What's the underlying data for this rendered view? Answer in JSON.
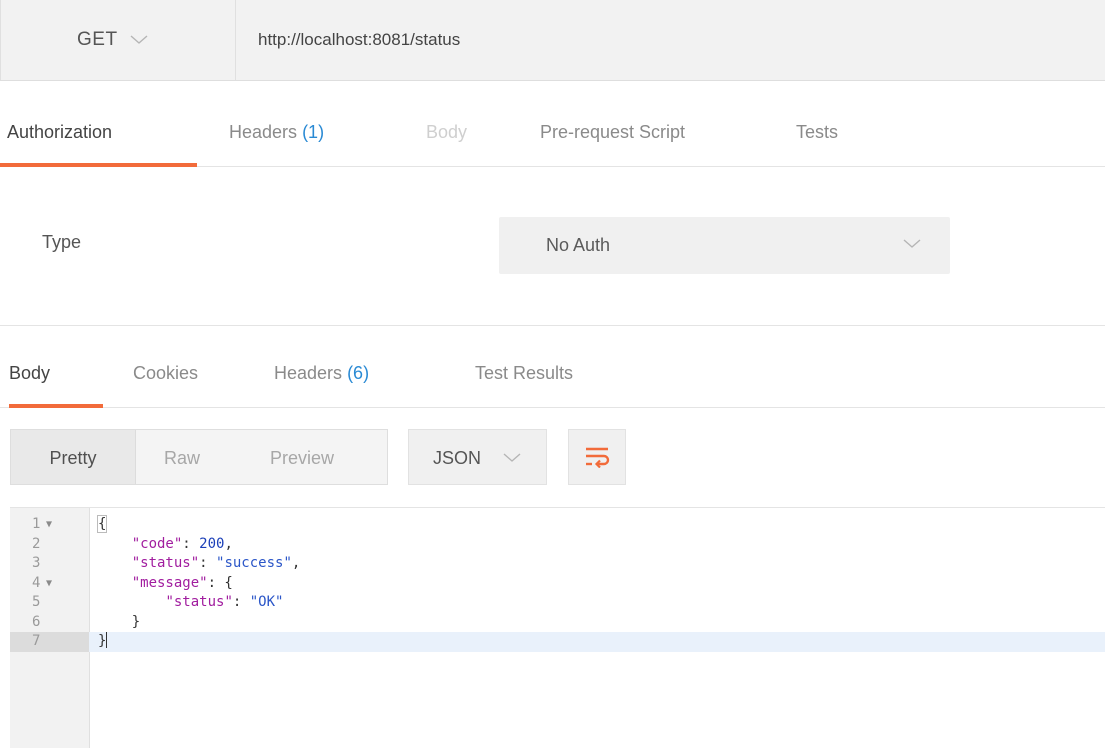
{
  "request": {
    "method": "GET",
    "url": "http://localhost:8081/status"
  },
  "request_tabs": [
    {
      "label": "Authorization",
      "count": "",
      "state": "active"
    },
    {
      "label": "Headers",
      "count": "(1)",
      "state": "normal"
    },
    {
      "label": "Body",
      "count": "",
      "state": "disabled"
    },
    {
      "label": "Pre-request Script",
      "count": "",
      "state": "normal"
    },
    {
      "label": "Tests",
      "count": "",
      "state": "normal"
    }
  ],
  "auth": {
    "type_label": "Type",
    "selected": "No Auth"
  },
  "response_tabs": [
    {
      "label": "Body",
      "count": "",
      "state": "active"
    },
    {
      "label": "Cookies",
      "count": "",
      "state": "normal"
    },
    {
      "label": "Headers",
      "count": "(6)",
      "state": "normal"
    },
    {
      "label": "Test Results",
      "count": "",
      "state": "normal"
    }
  ],
  "view_modes": [
    "Pretty",
    "Raw",
    "Preview"
  ],
  "active_view": "Pretty",
  "format": "JSON",
  "icons": {
    "method_dropdown": "chevron-down-icon",
    "auth_dropdown": "chevron-down-icon",
    "format_dropdown": "chevron-down-icon",
    "wrap": "wrap-lines-icon",
    "fold": "fold-arrow-icon"
  },
  "colors": {
    "accent": "#f26b3a",
    "count": "#2a8ad4",
    "json_key": "#a11d9f",
    "json_string": "#2b56c8",
    "json_number": "#1b3fb8",
    "current_line": "#e9f1fb"
  },
  "editor": {
    "lines": [
      {
        "num": "1",
        "fold": true,
        "text": "{"
      },
      {
        "num": "2",
        "fold": false,
        "text": "    \"code\": 200,"
      },
      {
        "num": "3",
        "fold": false,
        "text": "    \"status\": \"success\","
      },
      {
        "num": "4",
        "fold": true,
        "text": "    \"message\": {"
      },
      {
        "num": "5",
        "fold": false,
        "text": "        \"status\": \"OK\""
      },
      {
        "num": "6",
        "fold": false,
        "text": "    }"
      },
      {
        "num": "7",
        "fold": false,
        "text": "}"
      }
    ],
    "current_line": 7
  }
}
